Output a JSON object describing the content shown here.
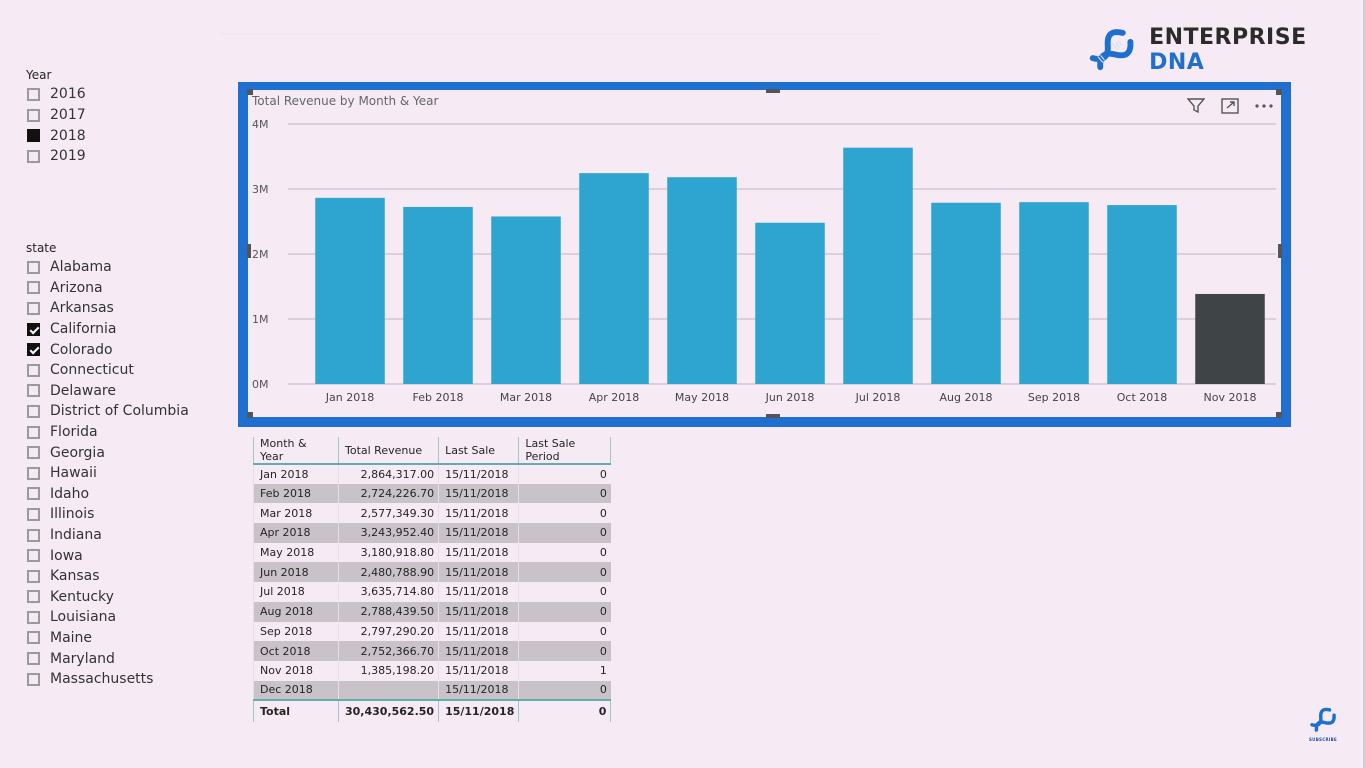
{
  "brand": {
    "logo_word1": "ENTERPRISE",
    "logo_word2": "DNA",
    "subscribe_label": "SUBSCRIBE",
    "accent_color": "#1f6fd0"
  },
  "year_slicer": {
    "title": "Year",
    "items": [
      {
        "label": "2016",
        "state": "unchecked"
      },
      {
        "label": "2017",
        "state": "unchecked"
      },
      {
        "label": "2018",
        "state": "filled"
      },
      {
        "label": "2019",
        "state": "unchecked"
      }
    ]
  },
  "state_slicer": {
    "title": "state",
    "items": [
      {
        "label": "Alabama",
        "state": "unchecked"
      },
      {
        "label": "Arizona",
        "state": "unchecked"
      },
      {
        "label": "Arkansas",
        "state": "unchecked"
      },
      {
        "label": "California",
        "state": "checked"
      },
      {
        "label": "Colorado",
        "state": "checked"
      },
      {
        "label": "Connecticut",
        "state": "unchecked"
      },
      {
        "label": "Delaware",
        "state": "unchecked"
      },
      {
        "label": "District of Columbia",
        "state": "unchecked"
      },
      {
        "label": "Florida",
        "state": "unchecked"
      },
      {
        "label": "Georgia",
        "state": "unchecked"
      },
      {
        "label": "Hawaii",
        "state": "unchecked"
      },
      {
        "label": "Idaho",
        "state": "unchecked"
      },
      {
        "label": "Illinois",
        "state": "unchecked"
      },
      {
        "label": "Indiana",
        "state": "unchecked"
      },
      {
        "label": "Iowa",
        "state": "unchecked"
      },
      {
        "label": "Kansas",
        "state": "unchecked"
      },
      {
        "label": "Kentucky",
        "state": "unchecked"
      },
      {
        "label": "Louisiana",
        "state": "unchecked"
      },
      {
        "label": "Maine",
        "state": "unchecked"
      },
      {
        "label": "Maryland",
        "state": "unchecked"
      },
      {
        "label": "Massachusetts",
        "state": "unchecked"
      }
    ]
  },
  "visual_icons": {
    "filter": "filter-icon",
    "focus": "focus-mode-icon",
    "more": "more-options-icon"
  },
  "chart_data": {
    "type": "bar",
    "title": "Total Revenue by Month & Year",
    "xlabel": "",
    "ylabel": "",
    "categories": [
      "Jan 2018",
      "Feb 2018",
      "Mar 2018",
      "Apr 2018",
      "May 2018",
      "Jun 2018",
      "Jul 2018",
      "Aug 2018",
      "Sep 2018",
      "Oct 2018",
      "Nov 2018"
    ],
    "values": [
      2864317.0,
      2724226.7,
      2577349.3,
      3243952.4,
      3180918.8,
      2480788.9,
      3635714.8,
      2788439.5,
      2797290.2,
      2752366.7,
      1385198.2
    ],
    "highlight_index": 10,
    "colors": {
      "default": "#2ea4d0",
      "highlight": "#3f4447"
    },
    "ylim": [
      0,
      4000000
    ],
    "yticks": [
      0,
      1000000,
      2000000,
      3000000,
      4000000
    ],
    "ytick_labels": [
      "0M",
      "1M",
      "2M",
      "3M",
      "4M"
    ],
    "grid": true,
    "legend": "none"
  },
  "table": {
    "headers": [
      "Month & Year",
      "Total Revenue",
      "Last Sale",
      "Last Sale Period"
    ],
    "rows": [
      [
        "Jan 2018",
        "2,864,317.00",
        "15/11/2018",
        "0"
      ],
      [
        "Feb 2018",
        "2,724,226.70",
        "15/11/2018",
        "0"
      ],
      [
        "Mar 2018",
        "2,577,349.30",
        "15/11/2018",
        "0"
      ],
      [
        "Apr 2018",
        "3,243,952.40",
        "15/11/2018",
        "0"
      ],
      [
        "May 2018",
        "3,180,918.80",
        "15/11/2018",
        "0"
      ],
      [
        "Jun 2018",
        "2,480,788.90",
        "15/11/2018",
        "0"
      ],
      [
        "Jul 2018",
        "3,635,714.80",
        "15/11/2018",
        "0"
      ],
      [
        "Aug 2018",
        "2,788,439.50",
        "15/11/2018",
        "0"
      ],
      [
        "Sep 2018",
        "2,797,290.20",
        "15/11/2018",
        "0"
      ],
      [
        "Oct 2018",
        "2,752,366.70",
        "15/11/2018",
        "0"
      ],
      [
        "Nov 2018",
        "1,385,198.20",
        "15/11/2018",
        "1"
      ],
      [
        "Dec 2018",
        "",
        "15/11/2018",
        "0"
      ]
    ],
    "total": [
      "Total",
      "30,430,562.50",
      "15/11/2018",
      "0"
    ]
  }
}
